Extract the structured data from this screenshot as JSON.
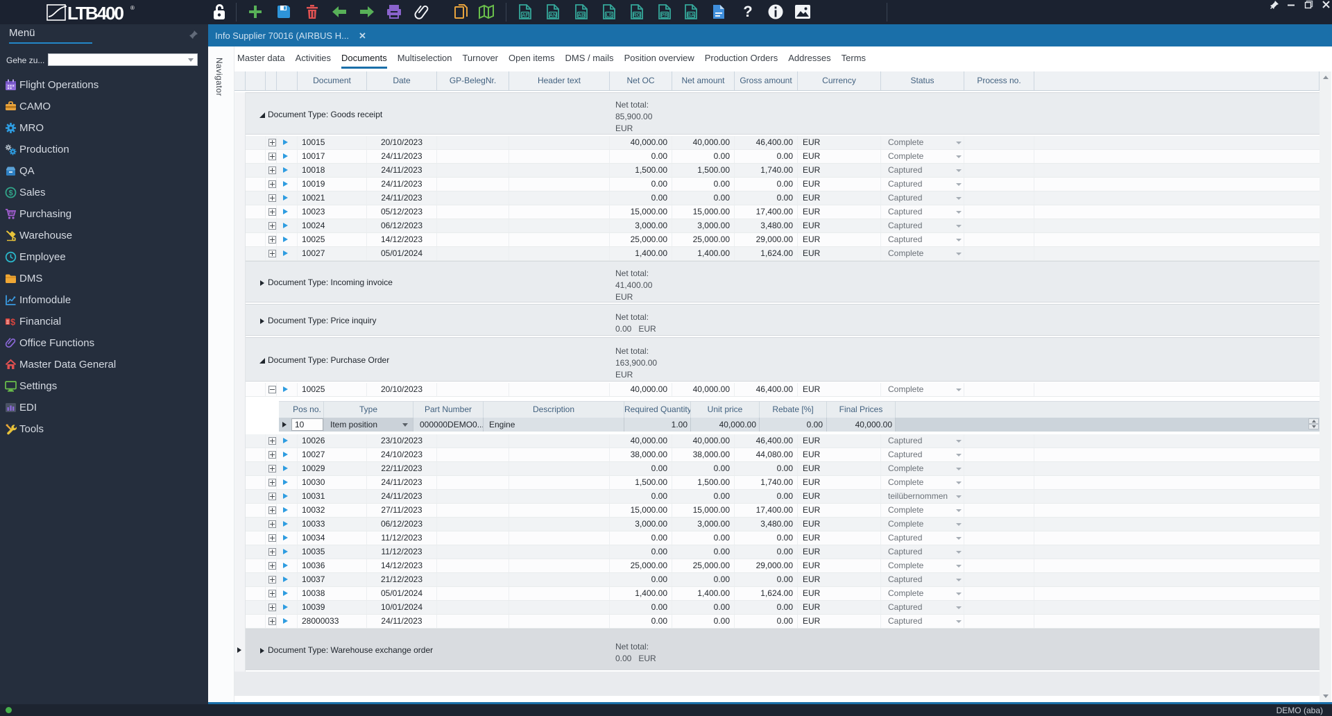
{
  "window": {
    "brand": "LTB400",
    "controls": [
      {
        "name": "pin"
      },
      {
        "name": "minimize"
      },
      {
        "name": "maximize"
      },
      {
        "name": "close"
      }
    ]
  },
  "toolbar": {
    "items": [
      {
        "name": "lock"
      },
      {
        "name": "separator"
      },
      {
        "name": "add"
      },
      {
        "name": "save"
      },
      {
        "name": "delete"
      },
      {
        "name": "back"
      },
      {
        "name": "forward"
      },
      {
        "name": "print"
      },
      {
        "name": "attachment"
      },
      {
        "name": "copy"
      },
      {
        "name": "map"
      },
      {
        "name": "separator"
      },
      {
        "name": "doc-af",
        "label": "AF"
      },
      {
        "name": "doc-an",
        "label": "AN"
      },
      {
        "name": "doc-ab",
        "label": "AB"
      },
      {
        "name": "doc-ls",
        "label": "LS"
      },
      {
        "name": "doc-rg",
        "label": "RG"
      },
      {
        "name": "doc-pr",
        "label": "PR"
      },
      {
        "name": "doc-ba",
        "label": "BA"
      },
      {
        "name": "doc-blue"
      },
      {
        "name": "help"
      },
      {
        "name": "info"
      },
      {
        "name": "image"
      },
      {
        "name": "separator"
      }
    ]
  },
  "sidebar": {
    "title": "Menü",
    "goto_label": "Gehe zu...",
    "goto_value": "",
    "items": [
      {
        "label": "Flight Operations",
        "icon": "calendar"
      },
      {
        "label": "CAMO",
        "icon": "camo"
      },
      {
        "label": "MRO",
        "icon": "gear"
      },
      {
        "label": "Production",
        "icon": "gears"
      },
      {
        "label": "QA",
        "icon": "box"
      },
      {
        "label": "Sales",
        "icon": "dollar-circle"
      },
      {
        "label": "Purchasing",
        "icon": "cart"
      },
      {
        "label": "Warehouse",
        "icon": "forklift"
      },
      {
        "label": "Employee",
        "icon": "clock"
      },
      {
        "label": "DMS",
        "icon": "folder"
      },
      {
        "label": "Infomodule",
        "icon": "chart"
      },
      {
        "label": "Financial",
        "icon": "finance"
      },
      {
        "label": "Office Functions",
        "icon": "paperclip"
      },
      {
        "label": "Master Data General",
        "icon": "home"
      },
      {
        "label": "Settings",
        "icon": "monitor"
      },
      {
        "label": "EDI",
        "icon": "bars"
      },
      {
        "label": "Tools",
        "icon": "tools"
      }
    ]
  },
  "tabstrip": {
    "active_tab": "Info Supplier 70016 (AIRBUS H...",
    "close_glyph": "✕"
  },
  "page": {
    "navigator_label": "Navigator",
    "tabs": [
      "Master data",
      "Activities",
      "Documents",
      "Multiselection",
      "Turnover",
      "Open items",
      "DMS / mails",
      "Position overview",
      "Production Orders",
      "Addresses",
      "Terms"
    ],
    "active_tab": "Documents"
  },
  "grid": {
    "columns": [
      "Document",
      "Date",
      "GP-BelegNr.",
      "Header text",
      "Net OC",
      "Net amount",
      "Gross amount",
      "Currency",
      "Status",
      "Process no."
    ],
    "groups": [
      {
        "label": "Document Type: Goods receipt",
        "expanded": true,
        "selected": false,
        "net_total_lines": [
          "Net total:",
          "85,900.00",
          "EUR"
        ],
        "rows": [
          {
            "document": "10015",
            "date": "20/10/2023",
            "net_oc": "40,000.00",
            "net_amount": "40,000.00",
            "gross_amount": "46,400.00",
            "currency": "EUR",
            "status": "Complete"
          },
          {
            "document": "10017",
            "date": "24/11/2023",
            "net_oc": "0.00",
            "net_amount": "0.00",
            "gross_amount": "0.00",
            "currency": "EUR",
            "status": "Complete"
          },
          {
            "document": "10018",
            "date": "24/11/2023",
            "net_oc": "1,500.00",
            "net_amount": "1,500.00",
            "gross_amount": "1,740.00",
            "currency": "EUR",
            "status": "Captured"
          },
          {
            "document": "10019",
            "date": "24/11/2023",
            "net_oc": "0.00",
            "net_amount": "0.00",
            "gross_amount": "0.00",
            "currency": "EUR",
            "status": "Captured"
          },
          {
            "document": "10021",
            "date": "24/11/2023",
            "net_oc": "0.00",
            "net_amount": "0.00",
            "gross_amount": "0.00",
            "currency": "EUR",
            "status": "Captured"
          },
          {
            "document": "10023",
            "date": "05/12/2023",
            "net_oc": "15,000.00",
            "net_amount": "15,000.00",
            "gross_amount": "17,400.00",
            "currency": "EUR",
            "status": "Captured"
          },
          {
            "document": "10024",
            "date": "06/12/2023",
            "net_oc": "3,000.00",
            "net_amount": "3,000.00",
            "gross_amount": "3,480.00",
            "currency": "EUR",
            "status": "Captured"
          },
          {
            "document": "10025",
            "date": "14/12/2023",
            "net_oc": "25,000.00",
            "net_amount": "25,000.00",
            "gross_amount": "29,000.00",
            "currency": "EUR",
            "status": "Captured"
          },
          {
            "document": "10027",
            "date": "05/01/2024",
            "net_oc": "1,400.00",
            "net_amount": "1,400.00",
            "gross_amount": "1,624.00",
            "currency": "EUR",
            "status": "Complete"
          }
        ]
      },
      {
        "label": "Document Type: Incoming invoice",
        "expanded": false,
        "selected": false,
        "net_total_lines": [
          "Net total:",
          "41,400.00",
          "EUR"
        ],
        "rows": []
      },
      {
        "label": "Document Type: Price inquiry",
        "expanded": false,
        "selected": false,
        "net_total_lines": [
          "Net total:",
          "0.00   EUR"
        ],
        "rows": []
      },
      {
        "label": "Document Type: Purchase Order",
        "expanded": true,
        "selected": false,
        "net_total_lines": [
          "Net total:",
          "163,900.00",
          "EUR"
        ],
        "rows": [
          {
            "document": "10025",
            "date": "20/10/2023",
            "net_oc": "40,000.00",
            "net_amount": "40,000.00",
            "gross_amount": "46,400.00",
            "currency": "EUR",
            "status": "Complete",
            "expanded": true,
            "has_detail": true
          },
          {
            "document": "10026",
            "date": "23/10/2023",
            "net_oc": "40,000.00",
            "net_amount": "40,000.00",
            "gross_amount": "46,400.00",
            "currency": "EUR",
            "status": "Captured"
          },
          {
            "document": "10027",
            "date": "24/10/2023",
            "net_oc": "38,000.00",
            "net_amount": "38,000.00",
            "gross_amount": "44,080.00",
            "currency": "EUR",
            "status": "Captured"
          },
          {
            "document": "10029",
            "date": "22/11/2023",
            "net_oc": "0.00",
            "net_amount": "0.00",
            "gross_amount": "0.00",
            "currency": "EUR",
            "status": "Complete"
          },
          {
            "document": "10030",
            "date": "24/11/2023",
            "net_oc": "1,500.00",
            "net_amount": "1,500.00",
            "gross_amount": "1,740.00",
            "currency": "EUR",
            "status": "Complete"
          },
          {
            "document": "10031",
            "date": "24/11/2023",
            "net_oc": "0.00",
            "net_amount": "0.00",
            "gross_amount": "0.00",
            "currency": "EUR",
            "status": "teilübernommen"
          },
          {
            "document": "10032",
            "date": "27/11/2023",
            "net_oc": "15,000.00",
            "net_amount": "15,000.00",
            "gross_amount": "17,400.00",
            "currency": "EUR",
            "status": "Complete"
          },
          {
            "document": "10033",
            "date": "06/12/2023",
            "net_oc": "3,000.00",
            "net_amount": "3,000.00",
            "gross_amount": "3,480.00",
            "currency": "EUR",
            "status": "Complete"
          },
          {
            "document": "10034",
            "date": "11/12/2023",
            "net_oc": "0.00",
            "net_amount": "0.00",
            "gross_amount": "0.00",
            "currency": "EUR",
            "status": "Captured"
          },
          {
            "document": "10035",
            "date": "11/12/2023",
            "net_oc": "0.00",
            "net_amount": "0.00",
            "gross_amount": "0.00",
            "currency": "EUR",
            "status": "Captured"
          },
          {
            "document": "10036",
            "date": "14/12/2023",
            "net_oc": "25,000.00",
            "net_amount": "25,000.00",
            "gross_amount": "29,000.00",
            "currency": "EUR",
            "status": "Complete"
          },
          {
            "document": "10037",
            "date": "21/12/2023",
            "net_oc": "0.00",
            "net_amount": "0.00",
            "gross_amount": "0.00",
            "currency": "EUR",
            "status": "Captured"
          },
          {
            "document": "10038",
            "date": "05/01/2024",
            "net_oc": "1,400.00",
            "net_amount": "1,400.00",
            "gross_amount": "1,624.00",
            "currency": "EUR",
            "status": "Complete"
          },
          {
            "document": "10039",
            "date": "10/01/2024",
            "net_oc": "0.00",
            "net_amount": "0.00",
            "gross_amount": "0.00",
            "currency": "EUR",
            "status": "Captured"
          },
          {
            "document": "28000033",
            "date": "24/11/2023",
            "net_oc": "0.00",
            "net_amount": "0.00",
            "gross_amount": "0.00",
            "currency": "EUR",
            "status": "Captured"
          }
        ]
      },
      {
        "label": "Document Type: Warehouse exchange order",
        "expanded": false,
        "selected": true,
        "net_total_lines": [
          "Net total:",
          "0.00   EUR"
        ],
        "rows": []
      }
    ],
    "detail": {
      "columns": [
        "Pos no.",
        "Type",
        "Part Number",
        "Description",
        "Required Quantity",
        "Unit price",
        "Rebate [%]",
        "Final Prices"
      ],
      "row": {
        "pos_no": "10",
        "type": "Item position",
        "part_number": "000000DEMO0...",
        "description": "Engine",
        "required_quantity": "1.00",
        "unit_price": "40,000.00",
        "rebate": "0.00",
        "final_prices": "40,000.00"
      }
    }
  },
  "statusbar": {
    "user": "DEMO (aba)"
  },
  "colors": {
    "topbar": "#1b2230",
    "sidebar": "#252e3d",
    "tabstrip_blue": "#1a6fa9",
    "status_green": "#47b04b",
    "group_bg": "#e9ecef",
    "header_text": "#42617f"
  }
}
